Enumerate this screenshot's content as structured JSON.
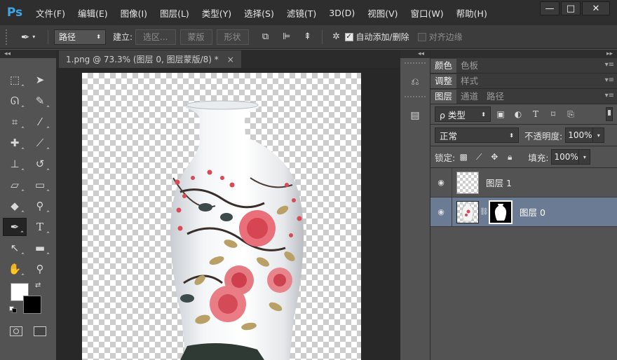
{
  "app": {
    "logo": "Ps",
    "menu": [
      "文件(F)",
      "编辑(E)",
      "图像(I)",
      "图层(L)",
      "类型(Y)",
      "选择(S)",
      "滤镜(T)",
      "3D(D)",
      "视图(V)",
      "窗口(W)",
      "帮助(H)"
    ],
    "window_controls": [
      "—",
      "□",
      "✕"
    ]
  },
  "options_bar": {
    "mode": "路径",
    "build_label": "建立:",
    "selection_btn": "选区...",
    "mask_btn": "蒙版",
    "shape_btn": "形状",
    "auto_add_delete": "自动添加/删除",
    "auto_add_delete_checked": true,
    "align_edges": "对齐边缘",
    "align_edges_checked": false
  },
  "document": {
    "tab_title": "1.png @ 73.3% (图层 0, 图层蒙版/8) *",
    "tab_close": "×"
  },
  "panels": {
    "row1": [
      "颜色",
      "色板"
    ],
    "row2": [
      "调整",
      "样式"
    ],
    "row3": [
      "图层",
      "通道",
      "路径"
    ]
  },
  "layers_panel": {
    "filter": "ρ 类型",
    "blend_mode": "正常",
    "opacity_label": "不透明度:",
    "opacity": "100%",
    "lock_label": "锁定:",
    "fill_label": "填充:",
    "fill": "100%",
    "layers": [
      {
        "name": "图层 1",
        "selected": false
      },
      {
        "name": "图层 0",
        "selected": true
      }
    ]
  },
  "colors": {
    "foreground": "#ffffff",
    "background": "#000000",
    "selection_highlight": "#6b7b93"
  },
  "icons": {
    "eye": "eye-icon",
    "link": "chain-link-icon",
    "pen": "pen-tool-icon"
  }
}
